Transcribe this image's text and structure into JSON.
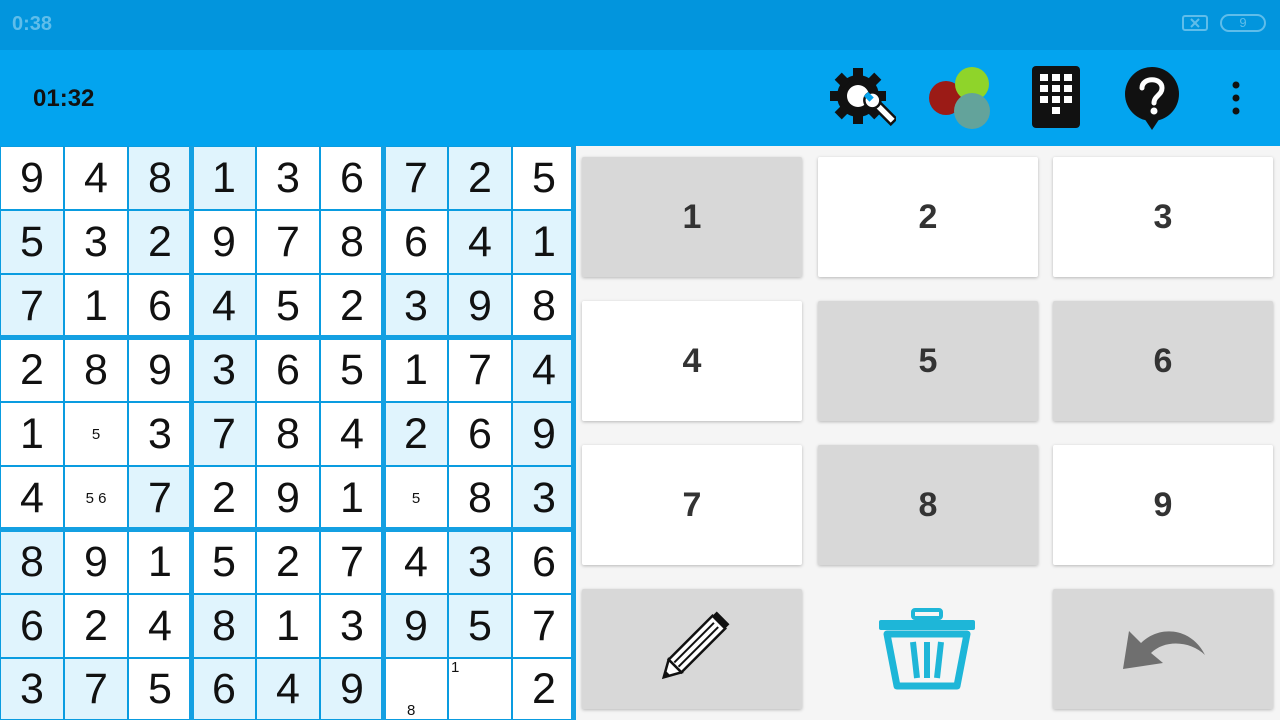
{
  "status": {
    "time": "0:38",
    "battery": "9"
  },
  "header": {
    "timer": "01:32"
  },
  "icons": {
    "settings": "gear-wrench-icon",
    "theme": "color-palette-icon",
    "numpad": "keypad-icon",
    "help": "help-question-icon",
    "more": "more-vertical-icon"
  },
  "colors": {
    "status_bar": "#0295dd",
    "app_bar": "#03a4ef",
    "shade": "#e0f4fd",
    "grid_line": "#0a9ce0",
    "trash": "#1eb6d8"
  },
  "board": {
    "cells": [
      [
        "9",
        "4",
        "8",
        "1",
        "3",
        "6",
        "7",
        "2",
        "5"
      ],
      [
        "5",
        "3",
        "2",
        "9",
        "7",
        "8",
        "6",
        "4",
        "1"
      ],
      [
        "7",
        "1",
        "6",
        "4",
        "5",
        "2",
        "3",
        "9",
        "8"
      ],
      [
        "2",
        "8",
        "9",
        "3",
        "6",
        "5",
        "1",
        "7",
        "4"
      ],
      [
        "1",
        "5",
        "3",
        "7",
        "8",
        "4",
        "2",
        "6",
        "9"
      ],
      [
        "4",
        "5 6",
        "7",
        "2",
        "9",
        "1",
        "5",
        "8",
        "3"
      ],
      [
        "8",
        "9",
        "1",
        "5",
        "2",
        "7",
        "4",
        "3",
        "6"
      ],
      [
        "6",
        "2",
        "4",
        "8",
        "1",
        "3",
        "9",
        "5",
        "7"
      ],
      [
        "3",
        "7",
        "5",
        "6",
        "4",
        "9",
        "8",
        "1",
        "2"
      ]
    ],
    "pencil_marks": [
      [
        4,
        1
      ],
      [
        5,
        1
      ],
      [
        5,
        6
      ],
      [
        8,
        6
      ],
      [
        8,
        7
      ]
    ],
    "shaded": [
      [
        0,
        2
      ],
      [
        0,
        3
      ],
      [
        0,
        6
      ],
      [
        0,
        7
      ],
      [
        1,
        0
      ],
      [
        1,
        2
      ],
      [
        1,
        7
      ],
      [
        1,
        8
      ],
      [
        2,
        0
      ],
      [
        2,
        3
      ],
      [
        2,
        6
      ],
      [
        2,
        7
      ],
      [
        3,
        3
      ],
      [
        3,
        8
      ],
      [
        4,
        3
      ],
      [
        4,
        6
      ],
      [
        4,
        8
      ],
      [
        5,
        2
      ],
      [
        5,
        8
      ],
      [
        6,
        0
      ],
      [
        6,
        7
      ],
      [
        7,
        0
      ],
      [
        7,
        3
      ],
      [
        7,
        6
      ],
      [
        7,
        7
      ],
      [
        8,
        0
      ],
      [
        8,
        1
      ],
      [
        8,
        3
      ],
      [
        8,
        4
      ],
      [
        8,
        5
      ]
    ]
  },
  "keypad": {
    "keys": [
      {
        "label": "1",
        "style": "gray"
      },
      {
        "label": "2",
        "style": "white"
      },
      {
        "label": "3",
        "style": "white"
      },
      {
        "label": "4",
        "style": "white"
      },
      {
        "label": "5",
        "style": "gray"
      },
      {
        "label": "6",
        "style": "gray"
      },
      {
        "label": "7",
        "style": "white"
      },
      {
        "label": "8",
        "style": "gray"
      },
      {
        "label": "9",
        "style": "white"
      }
    ],
    "tools": [
      "pencil-icon",
      "trash-icon",
      "undo-icon"
    ]
  }
}
